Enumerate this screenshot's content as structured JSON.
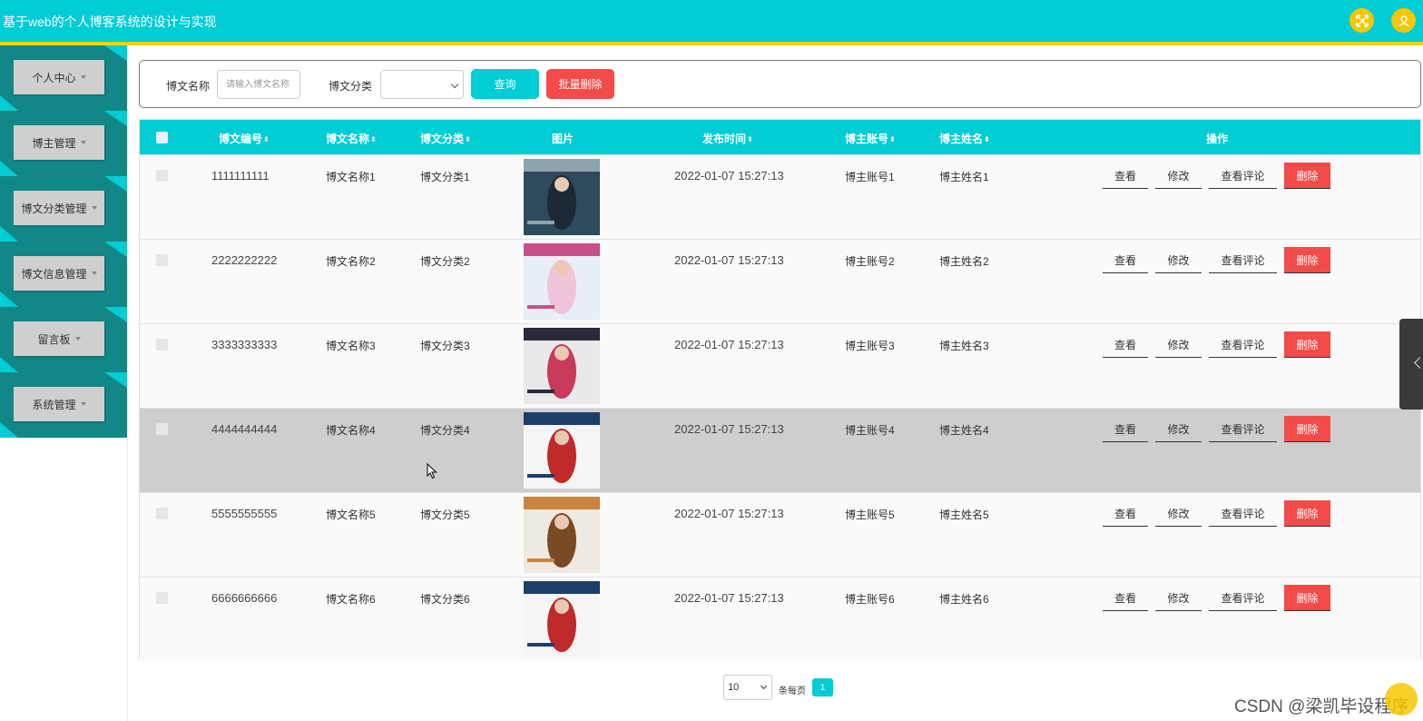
{
  "header": {
    "title": "基于web的个人博客系统的设计与实现",
    "icons": [
      "fullscreen-icon",
      "user-icon"
    ]
  },
  "sidebar": {
    "items": [
      {
        "label": "个人中心"
      },
      {
        "label": "博主管理"
      },
      {
        "label": "博文分类管理"
      },
      {
        "label": "博文信息管理"
      },
      {
        "label": "留言板"
      },
      {
        "label": "系统管理"
      }
    ]
  },
  "search": {
    "name_label": "博文名称",
    "name_placeholder": "请输入博文名称",
    "category_label": "博文分类",
    "category_value": "",
    "query_button": "查询",
    "batch_delete_button": "批量删除"
  },
  "table": {
    "columns": [
      "博文编号",
      "博文名称",
      "博文分类",
      "图片",
      "发布时间",
      "博主账号",
      "博主姓名",
      "操作"
    ],
    "rows": [
      {
        "id": "1111111111",
        "name": "博文名称1",
        "category": "博文分类1",
        "time": "2022-01-07 15:27:13",
        "account": "博主账号1",
        "author": "博主姓名1"
      },
      {
        "id": "2222222222",
        "name": "博文名称2",
        "category": "博文分类2",
        "time": "2022-01-07 15:27:13",
        "account": "博主账号2",
        "author": "博主姓名2"
      },
      {
        "id": "3333333333",
        "name": "博文名称3",
        "category": "博文分类3",
        "time": "2022-01-07 15:27:13",
        "account": "博主账号3",
        "author": "博主姓名3"
      },
      {
        "id": "4444444444",
        "name": "博文名称4",
        "category": "博文分类4",
        "time": "2022-01-07 15:27:13",
        "account": "博主账号4",
        "author": "博主姓名4"
      },
      {
        "id": "5555555555",
        "name": "博文名称5",
        "category": "博文分类5",
        "time": "2022-01-07 15:27:13",
        "account": "博主账号5",
        "author": "博主姓名5"
      },
      {
        "id": "6666666666",
        "name": "博文名称6",
        "category": "博文分类6",
        "time": "2022-01-07 15:27:13",
        "account": "博主账号6",
        "author": "博主姓名6"
      }
    ],
    "actions": {
      "view": "查看",
      "edit": "修改",
      "view_comments": "查看评论",
      "delete": "删除"
    }
  },
  "pagination": {
    "page_size": "10",
    "page_size_label": "条每页",
    "current_page": "1"
  },
  "watermark": "CSDN @梁凯毕设程序",
  "colors": {
    "primary": "#00cdd4",
    "accent_stripe": "#f2d600",
    "danger": "#f34a4a",
    "sidebar_dark": "#128787",
    "hover_row": "#cecece"
  }
}
